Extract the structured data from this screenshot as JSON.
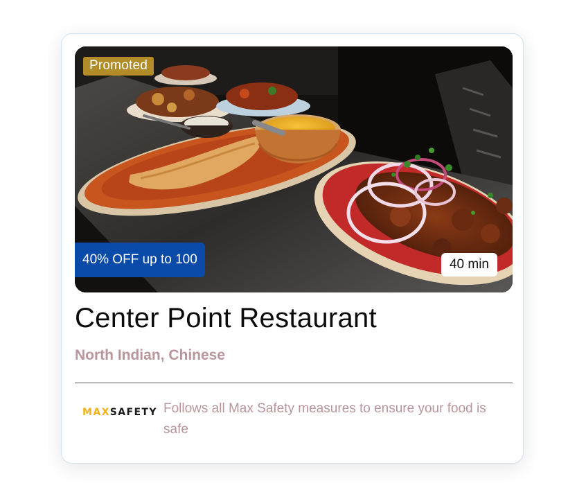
{
  "restaurant": {
    "name": "Center Point Restaurant",
    "cuisines": "North Indian, Chinese"
  },
  "badges": {
    "promoted": "Promoted",
    "offer": "40% OFF up to 100",
    "delivery_time": "40 min"
  },
  "safety": {
    "logo_max": "MAX",
    "logo_safety": "SAFETY",
    "message": "Follows all Max Safety measures to ensure your food is safe"
  },
  "colors": {
    "promoted_bg": "#be9628",
    "offer_bg": "#0a4aa8",
    "cuisine_text": "#b9959a",
    "logo_max": "#f2b21a",
    "card_border": "#cfe3f3"
  }
}
